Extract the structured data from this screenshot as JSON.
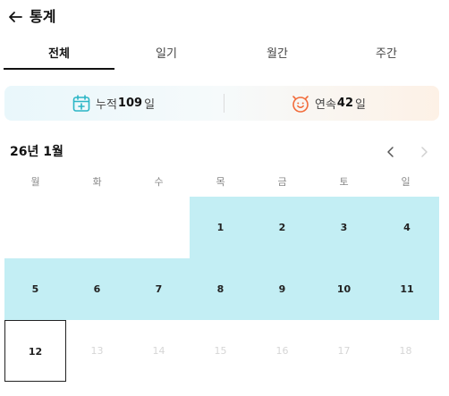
{
  "header": {
    "title": "통계",
    "back_icon": "arrow-left-icon"
  },
  "tabs": [
    {
      "label": "전체",
      "active": true
    },
    {
      "label": "일기",
      "active": false
    },
    {
      "label": "월간",
      "active": false
    },
    {
      "label": "주간",
      "active": false
    }
  ],
  "summary": {
    "total": {
      "icon": "calendar-add-icon",
      "label": "누적",
      "value": "109",
      "unit": "일"
    },
    "streak": {
      "icon": "face-alarm-icon",
      "label": "연속",
      "value": "42",
      "unit": "일"
    }
  },
  "calendar": {
    "month_label": "26년 1월",
    "prev_icon": "chevron-left-icon",
    "next_icon": "chevron-right-icon",
    "weekdays": [
      "월",
      "화",
      "수",
      "목",
      "금",
      "토",
      "일"
    ],
    "days": [
      {
        "d": "1",
        "state": "recorded"
      },
      {
        "d": "2",
        "state": "recorded"
      },
      {
        "d": "3",
        "state": "recorded"
      },
      {
        "d": "4",
        "state": "recorded"
      },
      {
        "d": "5",
        "state": "recorded"
      },
      {
        "d": "6",
        "state": "recorded"
      },
      {
        "d": "7",
        "state": "recorded"
      },
      {
        "d": "8",
        "state": "recorded"
      },
      {
        "d": "9",
        "state": "recorded"
      },
      {
        "d": "10",
        "state": "recorded"
      },
      {
        "d": "11",
        "state": "recorded"
      },
      {
        "d": "12",
        "state": "today"
      },
      {
        "d": "13",
        "state": "future"
      },
      {
        "d": "14",
        "state": "future"
      },
      {
        "d": "15",
        "state": "future"
      },
      {
        "d": "16",
        "state": "future"
      },
      {
        "d": "17",
        "state": "future"
      },
      {
        "d": "18",
        "state": "future"
      }
    ]
  },
  "colors": {
    "highlight": "#c3eef4",
    "future_text": "#d6d6d6",
    "accent_calendar": "#2bb6c6",
    "accent_streak": "#f26b3a"
  }
}
